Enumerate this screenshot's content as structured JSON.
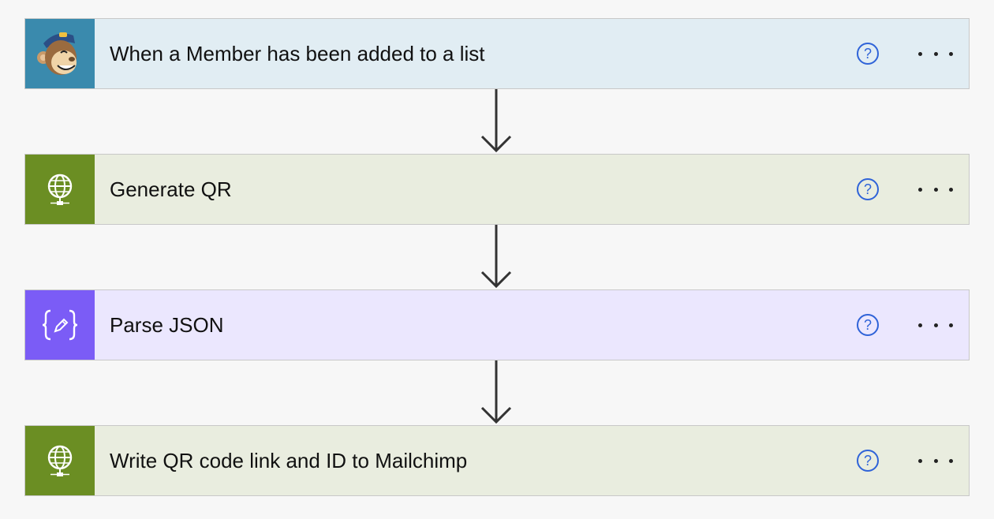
{
  "steps": [
    {
      "title": "When a Member has been added to a list",
      "icon": "mailchimp-logo",
      "icon_bg": "#3a8aad",
      "card_bg": "#e1edf3",
      "help_label": "?",
      "more_label": "More options"
    },
    {
      "title": "Generate QR",
      "icon": "globe-icon",
      "icon_bg": "#6b8e23",
      "card_bg": "#e9eddf",
      "help_label": "?",
      "more_label": "More options"
    },
    {
      "title": "Parse JSON",
      "icon": "json-braces-icon",
      "icon_bg": "#7b5cf6",
      "card_bg": "#ebe7fe",
      "help_label": "?",
      "more_label": "More options"
    },
    {
      "title": "Write QR code link and ID to Mailchimp",
      "icon": "globe-icon",
      "icon_bg": "#6b8e23",
      "card_bg": "#e9eddf",
      "help_label": "?",
      "more_label": "More options"
    }
  ],
  "colors": {
    "help_accent": "#2f63d8",
    "connector": "#333333",
    "page_bg": "#f7f7f7"
  }
}
